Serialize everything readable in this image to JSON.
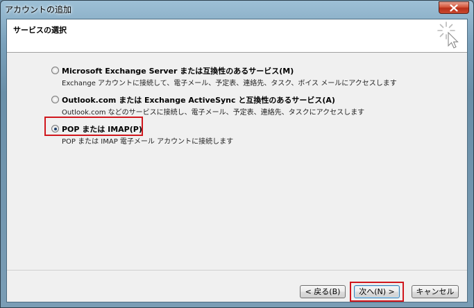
{
  "window": {
    "title": "アカウントの追加"
  },
  "header": {
    "title": "サービスの選択"
  },
  "options": [
    {
      "label": "Microsoft Exchange Server または互換性のあるサービス(M)",
      "description": "Exchange アカウントに接続して、電子メール、予定表、連絡先、タスク、ボイス メールにアクセスします",
      "checked": false
    },
    {
      "label": "Outlook.com または Exchange ActiveSync と互換性のあるサービス(A)",
      "description": "Outlook.com などのサービスに接続し、電子メール、予定表、連絡先、タスクにアクセスします",
      "checked": false
    },
    {
      "label": "POP または IMAP(P)",
      "description": "POP または IMAP 電子メール アカウントに接続します",
      "checked": true
    }
  ],
  "buttons": {
    "back": "< 戻る(B)",
    "next": "次へ(N) >",
    "cancel": "キャンセル"
  },
  "colors": {
    "highlight": "#d0161c",
    "title_bar": "#7aa1bb",
    "close_button": "#c9482e"
  },
  "icons": {
    "close": "close-x-icon",
    "wizard": "sparkle-cursor-icon"
  }
}
